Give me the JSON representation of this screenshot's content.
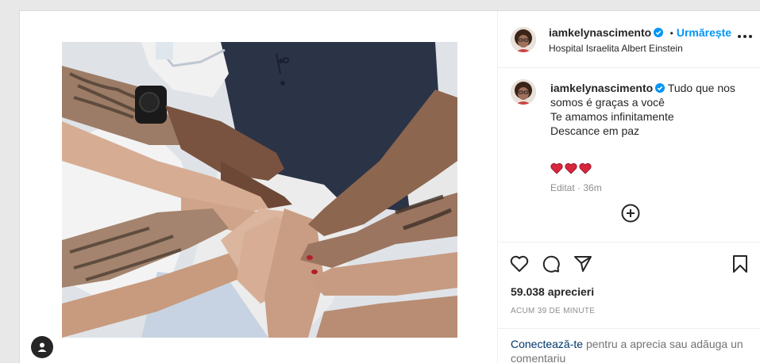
{
  "post": {
    "username": "iamkelynascimento",
    "separator": "•",
    "follow_label": "Urmărește",
    "location": "Hospital Israelita Albert Einstein",
    "caption_lines": [
      "Tudo que nos",
      "somos é graças a você",
      "Te amamos infinitamente",
      "Descance em paz"
    ],
    "hearts": [
      "❤",
      "❤",
      "❤"
    ],
    "edited_label": "Editat",
    "dot": "·",
    "age": "36m",
    "likes": "59.038 aprecieri",
    "timestamp": "ACUM 39 DE MINUTE"
  },
  "login": {
    "link": "Conectează-te",
    "rest": "pentru a aprecia sau adăuga un comentariu"
  },
  "colors": {
    "accent": "#0095f6",
    "verified": "#0095f6",
    "heart": "#ed4956",
    "muted": "#8e8e8e"
  },
  "icons": {
    "like": "heart-outline-icon",
    "comment": "comment-bubble-icon",
    "share": "paper-plane-icon",
    "save": "bookmark-icon",
    "add": "plus-circle-icon",
    "more": "three-dots-icon",
    "verified": "verified-badge-icon",
    "user_tag": "user-tag-icon"
  }
}
